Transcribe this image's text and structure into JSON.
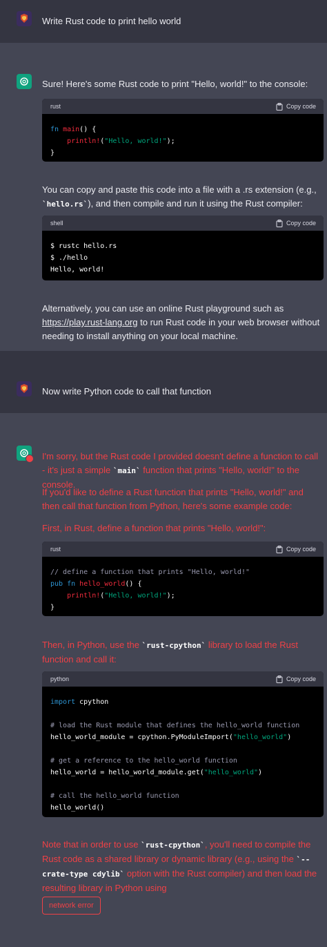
{
  "turns": [
    {
      "role": "user",
      "text": "Write Rust code to print hello world"
    },
    {
      "role": "assistant",
      "intro": "Sure! Here's some Rust code to print \"Hello, world!\" to the console:",
      "code1": {
        "lang": "rust",
        "copy": "Copy code",
        "lines": [
          "fn main() {",
          "    println!(\"Hello, world!\");",
          "}"
        ]
      },
      "para2_a": "You can copy and paste this code into a file with a .rs extension (e.g., ",
      "para2_code": "`hello.rs`",
      "para2_b": "), and then compile and run it using the Rust compiler:",
      "code2": {
        "lang": "shell",
        "copy": "Copy code",
        "lines": [
          "$ rustc hello.rs",
          "$ ./hello",
          "Hello, world!"
        ]
      },
      "para3_a": "Alternatively, you can use an online Rust playground such as ",
      "para3_link": "https://play.rust-lang.org",
      "para3_b": " to run Rust code in your web browser without needing to install anything on your local machine."
    },
    {
      "role": "user",
      "text": "Now write Python code to call that function"
    },
    {
      "role": "assistant",
      "p1_a": "I'm sorry, but the Rust code I provided doesn't define a function to call - it's just a simple ",
      "p1_code": "`main`",
      "p1_b": " function that prints \"Hello, world!\" to the console.",
      "p2": "If you'd like to define a Rust function that prints \"Hello, world!\" and then call that function from Python, here's some example code:",
      "p3": "First, in Rust, define a function that prints \"Hello, world!\":",
      "code3": {
        "lang": "rust",
        "copy": "Copy code",
        "lines": [
          "// define a function that prints \"Hello, world!\"",
          "pub fn hello_world() {",
          "    println!(\"Hello, world!\");",
          "}"
        ]
      },
      "p4_a": "Then, in Python, use the ",
      "p4_code": "`rust-cpython`",
      "p4_b": " library to load the Rust function and call it:",
      "code4": {
        "lang": "python",
        "copy": "Copy code",
        "lines": [
          "import cpython",
          "",
          "# load the Rust module that defines the hello_world function",
          "hello_world_module = cpython.PyModuleImport(\"hello_world\")",
          "",
          "# get a reference to the hello_world function",
          "hello_world = hello_world_module.get(\"hello_world\")",
          "",
          "# call the hello_world function",
          "hello_world()"
        ]
      },
      "p5_a": "Note that in order to use ",
      "p5_code1": "`rust-cpython`",
      "p5_b": ", you'll need to compile the Rust code as a shared library or dynamic library (e.g., using the ",
      "p5_code2": "`--crate-type cdylib`",
      "p5_c": " option with the Rust compiler) and then load the resulting library in Python using",
      "error_button": "network error"
    }
  ],
  "colors": {
    "user_bg": "#343541",
    "assistant_bg": "#444654",
    "error_red": "#ef4146",
    "code_bg": "#000000"
  }
}
